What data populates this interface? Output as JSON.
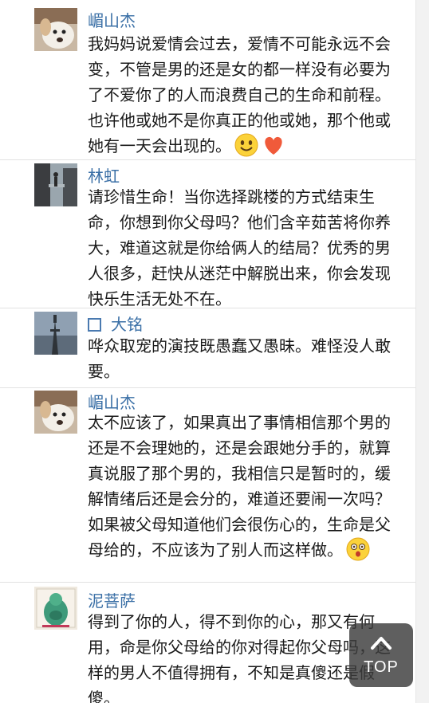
{
  "comments": [
    {
      "user": "嵋山杰",
      "text": "我妈妈说爱情会过去，爱情不可能永远不会变，不管是男的还是女的都一样没有必要为了不爱你了的人而浪费自己的生命和前程。也许他或她不是你真正的他或她，那个他或她有一天会出现的。",
      "emojis": [
        "smile-emoji",
        "heart-emoji"
      ]
    },
    {
      "user": "林虹",
      "text": "请珍惜生命！当你选择跳楼的方式结束生命，你想到你父母吗？他们含辛茹苦将你养大，难道这就是你给俩人的结局？优秀的男人很多，赶快从迷茫中解脱出来，你会发现快乐生活无处不在。"
    },
    {
      "user": "大铭",
      "text": "哗众取宠的演技既愚蠢又愚昧。难怪没人敢要。"
    },
    {
      "user": "嵋山杰",
      "text": "太不应该了，如果真出了事情相信那个男的还是不会理她的，还是会跟她分手的，就算真说服了那个男的，我相信只是暂时的，缓解情绪后还是会分的，难道还要闹一次吗？如果被父母知道他们会很伤心的，生命是父母给的，不应该为了别人而这样做。",
      "emojis": [
        "shocked-emoji"
      ]
    },
    {
      "user": "泥菩萨",
      "text": "得到了你的人，得不到你的心，那又有何用，命是你父母给的你对得起你父母吗，这样的男人不值得拥有，不知是真傻还是假傻。"
    }
  ],
  "top_button": {
    "label": "TOP",
    "icon": "chevron-up-icon"
  },
  "colors": {
    "username": "#3a6fa6",
    "text": "#1a1a1a",
    "divider": "#e2e2e2"
  }
}
